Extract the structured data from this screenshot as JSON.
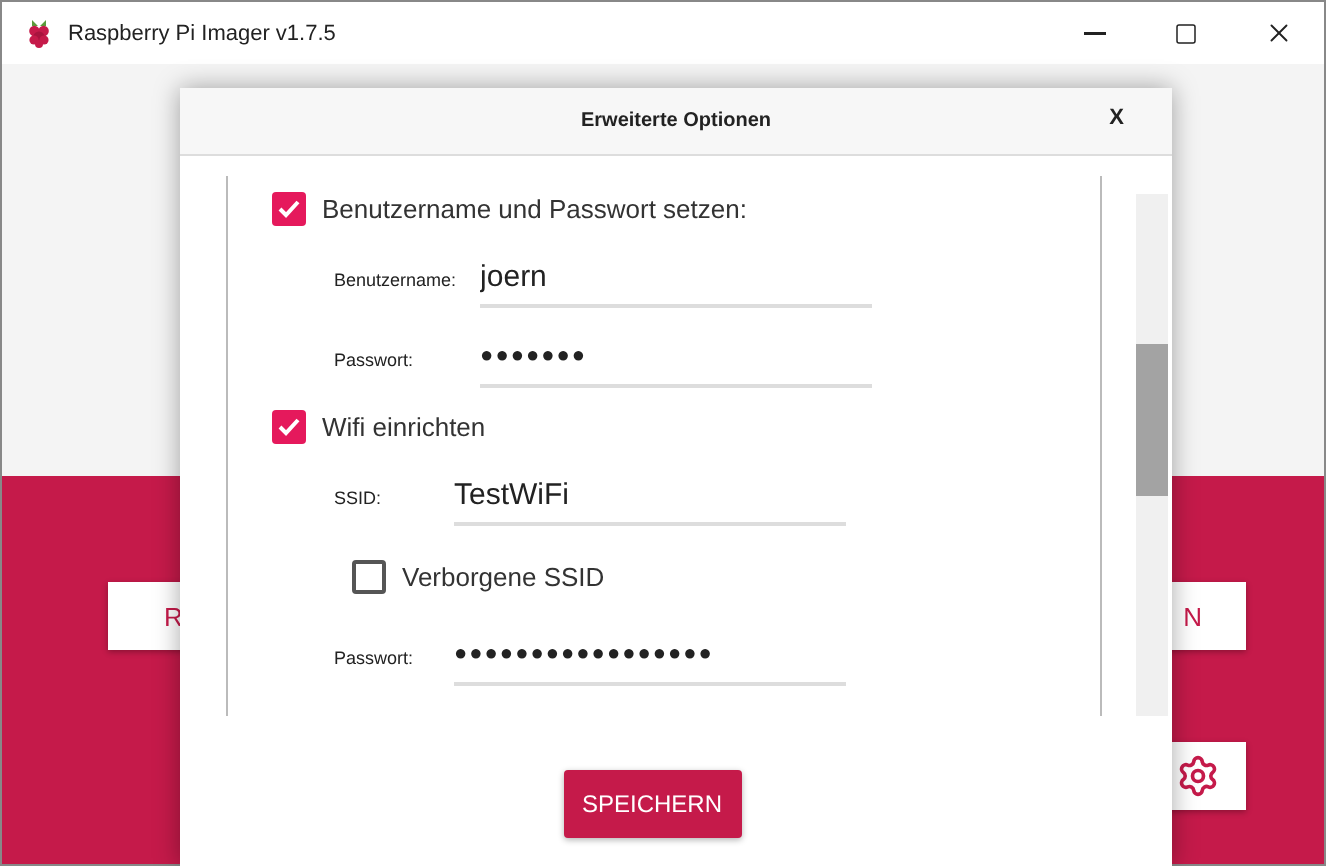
{
  "window": {
    "title": "Raspberry Pi Imager v1.7.5"
  },
  "background": {
    "buttons": [
      {
        "label": "R"
      },
      {
        "label": "N"
      }
    ]
  },
  "dialog": {
    "title": "Erweiterte Optionen",
    "close": "X",
    "save_button": "SPEICHERN",
    "items": [
      {
        "kind": "checkbox",
        "label": "Benutzername und Passwort setzen:",
        "checked": true,
        "children": [
          {
            "kind": "text",
            "label": "Benutzername:",
            "value": "joern"
          },
          {
            "kind": "password",
            "label": "Passwort:",
            "value": "●●●●●●●"
          }
        ]
      },
      {
        "kind": "checkbox",
        "label": "Wifi einrichten",
        "checked": true,
        "children": [
          {
            "kind": "text",
            "label": "SSID:",
            "value": "TestWiFi"
          },
          {
            "kind": "checkbox",
            "label": "Verborgene SSID",
            "checked": false
          },
          {
            "kind": "password",
            "label": "Passwort:",
            "value": "●●●●●●●●●●●●●●●●●"
          }
        ]
      }
    ]
  }
}
